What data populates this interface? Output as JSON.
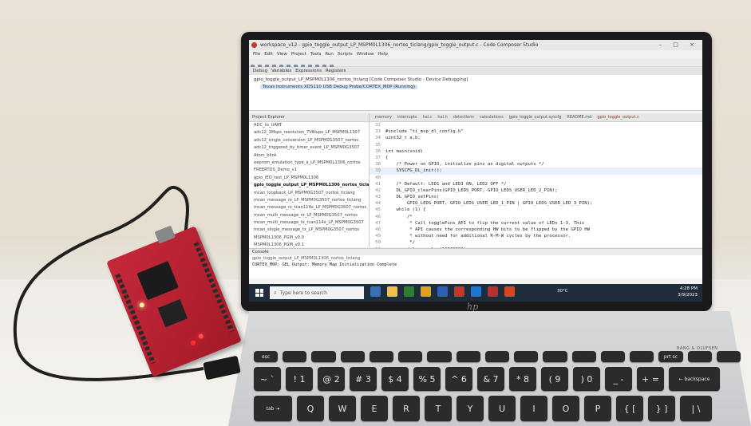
{
  "window": {
    "title": "workspace_v12 - gpio_toggle_output_LP_MSPM0L1306_nortos_ticlang/gpio_toggle_output.c - Code Composer Studio",
    "controls": "–  □  ×"
  },
  "menu": [
    "File",
    "Edit",
    "View",
    "Project",
    "Tools",
    "Run",
    "Scripts",
    "Window",
    "Help"
  ],
  "debug_tabs": [
    "Debug",
    "Variables",
    "Expressions",
    "Registers"
  ],
  "debug_session": {
    "line1": "gpio_toggle_output_LP_MSPM0L1306_nortos_ticlang [Code Composer Studio - Device Debugging]",
    "line2": "Texas Instruments XDS110 USB Debug Probe/CORTEX_M0P (Running)"
  },
  "explorer": {
    "header": "Project Explorer",
    "items": [
      "ADC_to_UART",
      "adc12_1Msps_resolution_7VBlups_LP_MSPM0L1307",
      "adc12_single_conversion_LP_MSPM0G3507_nortos",
      "adc12_triggered_by_timer_event_LP_MSPM0G3507",
      "Atom_blink",
      "eeprom_emulation_type_a_LP_MSPM0L1306_nortos",
      "FREERTOS_Demo_v1",
      "gpio_IEO_test_LP_MSPM0L1306",
      "gpio_toggle_output_LP_MSPM0L1306_nortos_ticlang",
      "mcan_loopback_LP_MSPM0G3507_nortos_ticlang",
      "mcan_message_rx_LP_MSPM0G3507_nortos_ticlang",
      "mcan_message_rx_tcan114x_LP_MSPM0G3507_nortos",
      "mcan_multi_message_rx_LP_MSPM0G3507_nortos",
      "mcan_multi_message_tx_tcan114x_LP_MSPM0G3507",
      "mcan_single_message_tx_LP_MSPM0G3507_nortos",
      "MSPM0L1306_PGM_v0.0",
      "MSPM0L1306_PGM_v0.1",
      "MSPM0L1306_PGM_v0.2"
    ],
    "selected_index": 8
  },
  "editor_tabs": [
    "memory",
    "interrupts",
    "hal.c",
    "hal.h",
    "detections",
    "calculations",
    "gpio_toggle_output.syscfg",
    "README.md",
    "gpio_toggle_output.c"
  ],
  "code_lines": [
    {
      "n": "32",
      "t": ""
    },
    {
      "n": "33",
      "t": "#include \"ti_msp_dl_config.h\""
    },
    {
      "n": "34",
      "t": "uint32_t a,b;"
    },
    {
      "n": "35",
      "t": ""
    },
    {
      "n": "36",
      "t": "int main(void)"
    },
    {
      "n": "37",
      "t": "{"
    },
    {
      "n": "38",
      "t": "    /* Power on GPIO, initialize pins as digital outputs */"
    },
    {
      "n": "39",
      "t": "    SYSCFG_DL_init();"
    },
    {
      "n": "40",
      "t": ""
    },
    {
      "n": "41",
      "t": "    /* Default: LED1 and LED3 ON, LED2 OFF */"
    },
    {
      "n": "42",
      "t": "    DL_GPIO_clearPins(GPIO_LEDS_PORT, GPIO_LEDS_USER_LED_2_PIN);"
    },
    {
      "n": "43",
      "t": "    DL_GPIO_setPins("
    },
    {
      "n": "44",
      "t": "        GPIO_LEDS_PORT, GPIO_LEDS_USER_LED_1_PIN | GPIO_LEDS_USER_LED_3_PIN);"
    },
    {
      "n": "45",
      "t": "    while (1) {"
    },
    {
      "n": "46",
      "t": "        /*"
    },
    {
      "n": "47",
      "t": "         * Call togglePins API to flip the current value of LEDs 1-3. This"
    },
    {
      "n": "48",
      "t": "         * API causes the corresponding HW bits to be flipped by the GPIO HW"
    },
    {
      "n": "49",
      "t": "         * without need for additional R-M-W cycles by the processor."
    },
    {
      "n": "50",
      "t": "         */"
    },
    {
      "n": "51",
      "t": "        delay_cycles(10000000);"
    },
    {
      "n": "52",
      "t": "        DL_GPIO_togglePins(GPIO_LEDS_PORT, GPIO_LEDS_USER_LED_1_PIN |"
    },
    {
      "n": "53",
      "t": "                                           GPIO_LEDS_USER_LED_2_PIN |"
    }
  ],
  "console": {
    "header": "Console",
    "line1": "gpio_toggle_output_LP_MSPM0L1306_nortos_ticlang",
    "line2": "CORTEX_M0P: GEL Output: Memory Map Initialization Complete"
  },
  "taskbar": {
    "search_placeholder": "Type here to search",
    "weather": "30°C",
    "time": "4:28 PM",
    "date": "3/9/2023"
  },
  "laptop": {
    "logo": "hp",
    "speaker_brand": "BANG & OLUFSEN"
  },
  "keyboard": {
    "fn_row": [
      "esc",
      "",
      "",
      "",
      "",
      "",
      "",
      "",
      "",
      "",
      "",
      "",
      "",
      "",
      "prt sc",
      "",
      ""
    ],
    "num_row": [
      "~ `",
      "! 1",
      "@ 2",
      "# 3",
      "$ 4",
      "% 5",
      "^ 6",
      "& 7",
      "* 8",
      "( 9",
      ") 0",
      "_ -",
      "+ =",
      "← backspace"
    ],
    "q_row": [
      "tab ⇥",
      "Q",
      "W",
      "E",
      "R",
      "T",
      "Y",
      "U",
      "I",
      "O",
      "P",
      "{ [",
      "} ]",
      "| \\"
    ]
  },
  "colors": {
    "board": "#c4283a",
    "taskbar": "#1e2c3c",
    "keys": "#2b2b2e"
  }
}
